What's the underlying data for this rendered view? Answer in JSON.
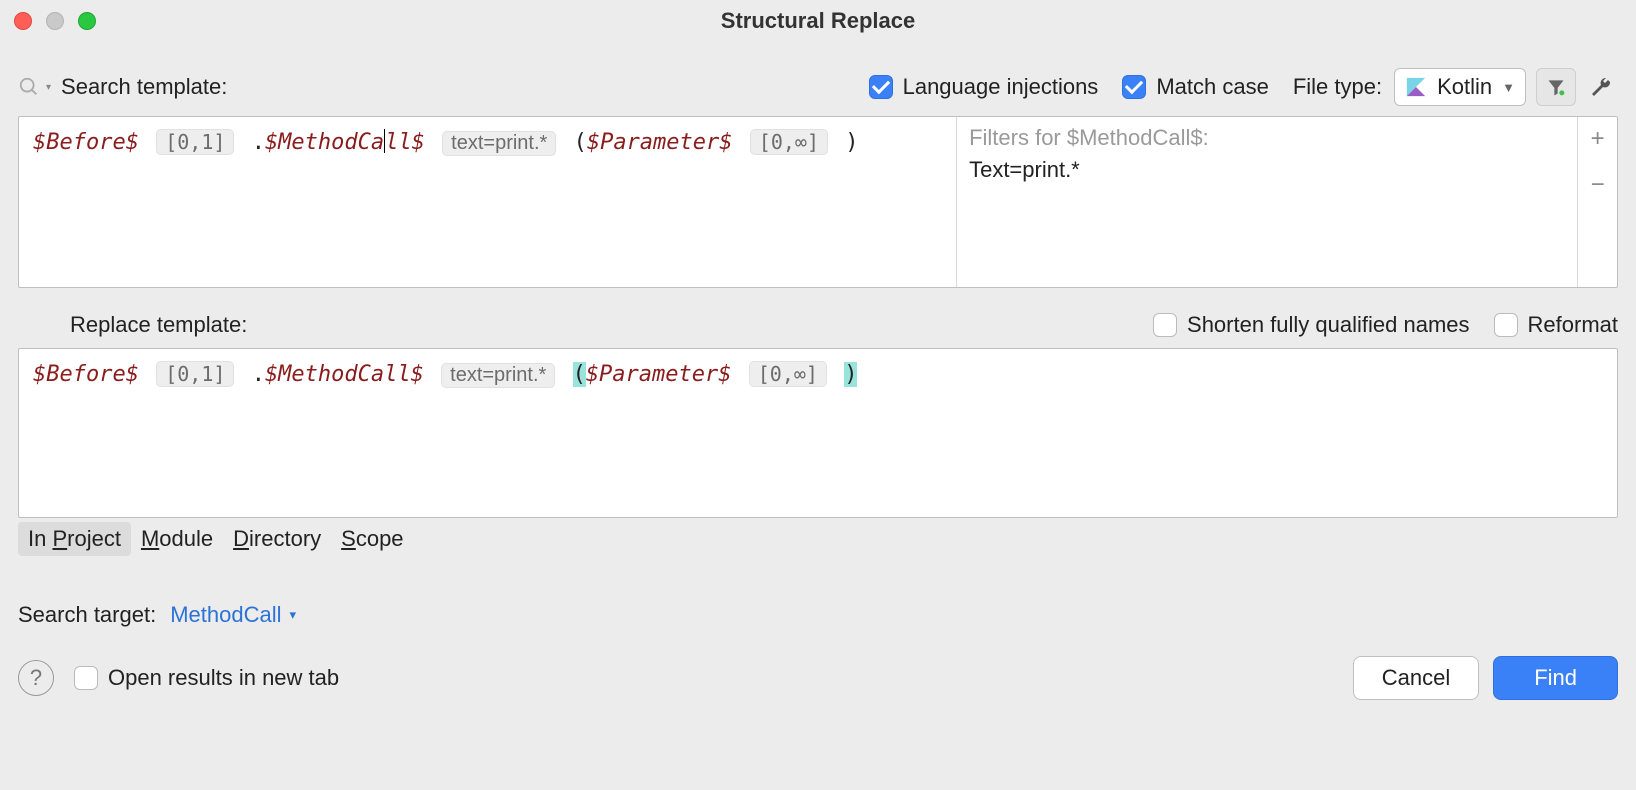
{
  "window": {
    "title": "Structural Replace"
  },
  "labels": {
    "search_template": "Search template:",
    "replace_template": "Replace template:",
    "file_type": "File type:",
    "search_target": "Search target:"
  },
  "options": {
    "language_injections": {
      "label": "Language injections",
      "checked": true
    },
    "match_case": {
      "label": "Match case",
      "checked": true
    },
    "shorten_fqn": {
      "label": "Shorten fully qualified names",
      "checked": false
    },
    "reformat": {
      "label": "Reformat",
      "checked": false
    },
    "open_in_new_tab": {
      "label": "Open results in new tab",
      "checked": false
    }
  },
  "file_type_select": {
    "value": "Kotlin"
  },
  "search_template_tokens": {
    "before_var": "$Before$",
    "before_count": "[0,1]",
    "dot": ".",
    "method_var_left": "$MethodCa",
    "method_var_right": "ll$",
    "method_filter": "text=print.*",
    "open_paren": "(",
    "param_var": "$Parameter$",
    "param_count": "[0,∞]",
    "close_paren": ")"
  },
  "replace_template_tokens": {
    "before_var": "$Before$",
    "before_count": "[0,1]",
    "dot": ".",
    "method_var": "$MethodCall$",
    "method_filter": "text=print.*",
    "open_paren": "(",
    "param_var": "$Parameter$",
    "param_count": "[0,∞]",
    "close_paren": ")"
  },
  "filters": {
    "title": "Filters for $MethodCall$:",
    "body": "Text=print.*"
  },
  "side_tools": {
    "add": "+",
    "remove": "−"
  },
  "scopes": [
    {
      "pre": "In ",
      "u": "P",
      "post": "roject",
      "active": true
    },
    {
      "pre": "",
      "u": "M",
      "post": "odule",
      "active": false
    },
    {
      "pre": "",
      "u": "D",
      "post": "irectory",
      "active": false
    },
    {
      "pre": "",
      "u": "S",
      "post": "cope",
      "active": false
    }
  ],
  "search_target_value": "MethodCall",
  "buttons": {
    "cancel": "Cancel",
    "find": "Find"
  },
  "help": "?"
}
